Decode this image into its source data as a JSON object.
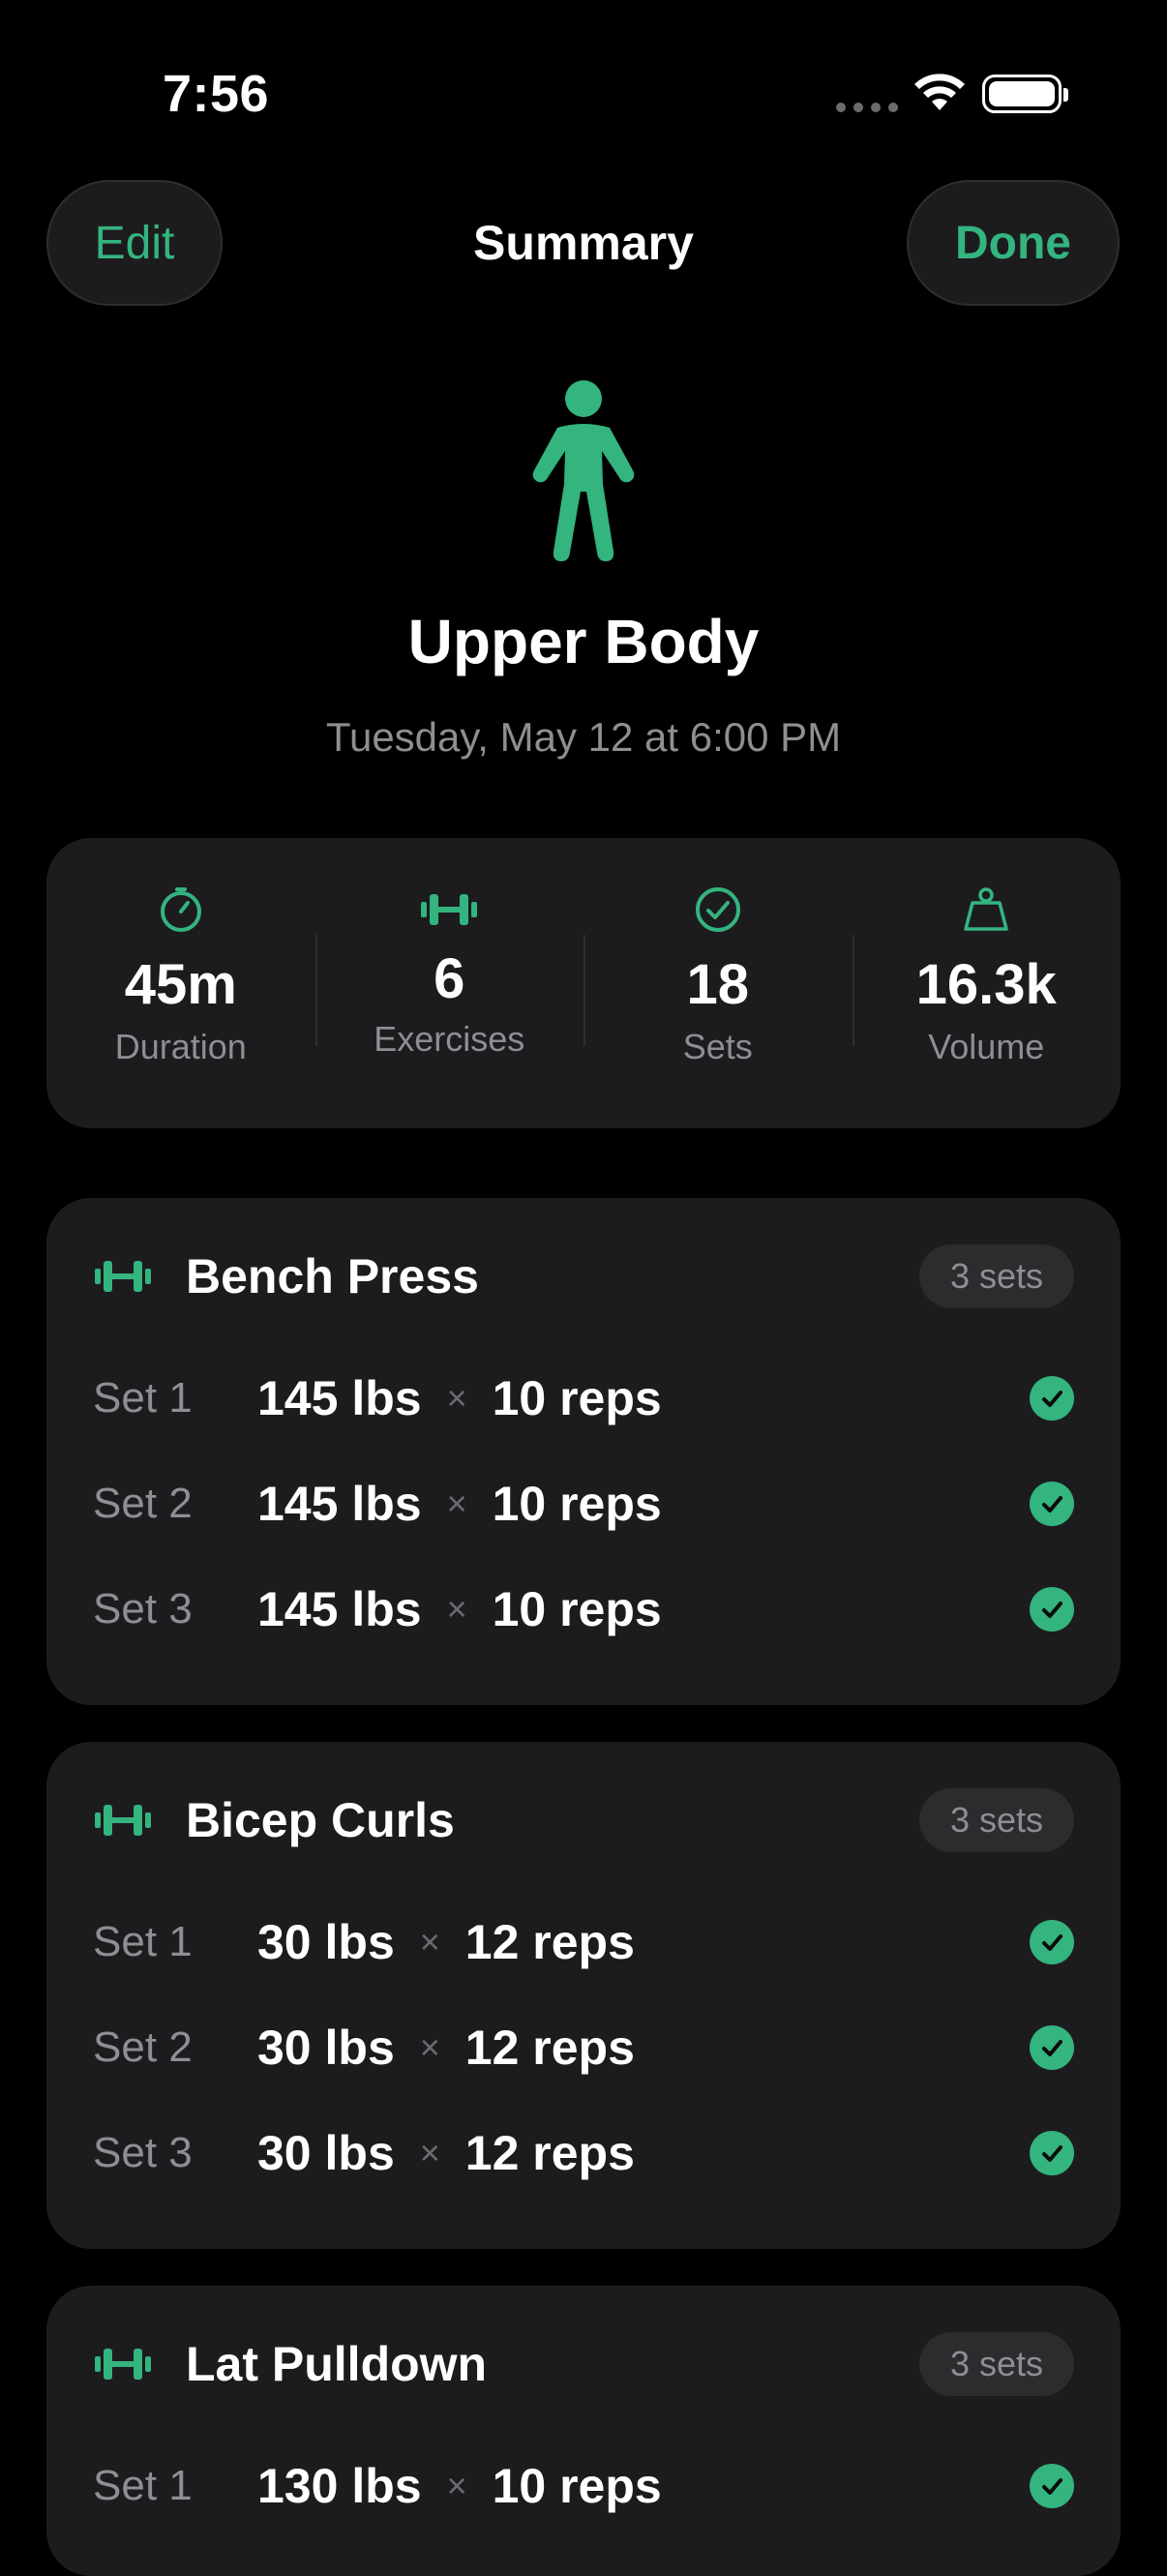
{
  "status_bar": {
    "time": "7:56"
  },
  "nav": {
    "edit_label": "Edit",
    "title": "Summary",
    "done_label": "Done"
  },
  "workout": {
    "title": "Upper Body",
    "date": "Tuesday, May 12 at 6:00 PM",
    "icon": "figure-standing-icon"
  },
  "stats": [
    {
      "icon": "timer-icon",
      "value": "45m",
      "label": "Duration"
    },
    {
      "icon": "dumbbell-icon",
      "value": "6",
      "label": "Exercises"
    },
    {
      "icon": "checkmark-circle-icon",
      "value": "18",
      "label": "Sets"
    },
    {
      "icon": "weight-icon",
      "value": "16.3k",
      "label": "Volume"
    }
  ],
  "exercises": [
    {
      "name": "Bench Press",
      "badge": "3 sets",
      "sets": [
        {
          "label": "Set 1",
          "weight": "145 lbs",
          "times": "×",
          "reps": "10 reps"
        },
        {
          "label": "Set 2",
          "weight": "145 lbs",
          "times": "×",
          "reps": "10 reps"
        },
        {
          "label": "Set 3",
          "weight": "145 lbs",
          "times": "×",
          "reps": "10 reps"
        }
      ]
    },
    {
      "name": "Bicep Curls",
      "badge": "3 sets",
      "sets": [
        {
          "label": "Set 1",
          "weight": "30 lbs",
          "times": "×",
          "reps": "12 reps"
        },
        {
          "label": "Set 2",
          "weight": "30 lbs",
          "times": "×",
          "reps": "12 reps"
        },
        {
          "label": "Set 3",
          "weight": "30 lbs",
          "times": "×",
          "reps": "12 reps"
        }
      ]
    },
    {
      "name": "Lat Pulldown",
      "badge": "3 sets",
      "sets": [
        {
          "label": "Set 1",
          "weight": "130 lbs",
          "times": "×",
          "reps": "10 reps"
        }
      ]
    }
  ],
  "colors": {
    "accent": "#34b47f",
    "background": "#000000",
    "card": "#1c1c1e",
    "secondary_text": "#8e8e93"
  }
}
